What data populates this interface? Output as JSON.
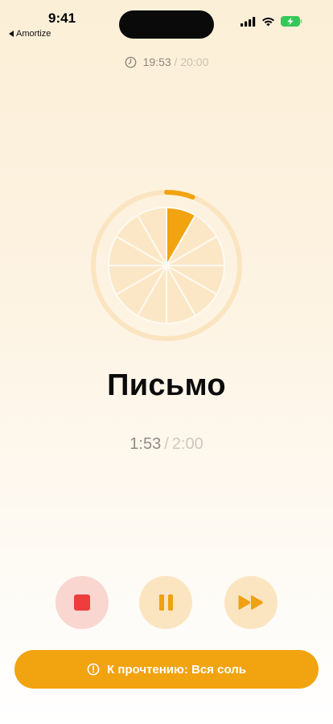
{
  "status_bar": {
    "time": "9:41",
    "back_app": "Amortize"
  },
  "total_timer": {
    "elapsed": "19:53",
    "separator": "/",
    "limit": "20:00"
  },
  "section": {
    "title": "Письмо",
    "elapsed": "1:53",
    "separator": "/",
    "limit": "2:00"
  },
  "dial": {
    "segments_total": 12,
    "segments_active": 1,
    "outer_progress_fraction": 0.0583
  },
  "controls": {
    "stop_icon": "stop-icon",
    "pause_icon": "pause-icon",
    "skip_icon": "fast-forward-icon"
  },
  "reading_banner": {
    "icon": "info-circle-icon",
    "label": "К прочтению: Вся соль"
  },
  "colors": {
    "accent": "#f2a310",
    "stop_red": "#ee3d3d",
    "stop_bg": "#f9d6d0",
    "control_bg": "#fbe5c1",
    "segment_fill": "#fbe7c6",
    "ring": "#fbe4c0"
  }
}
